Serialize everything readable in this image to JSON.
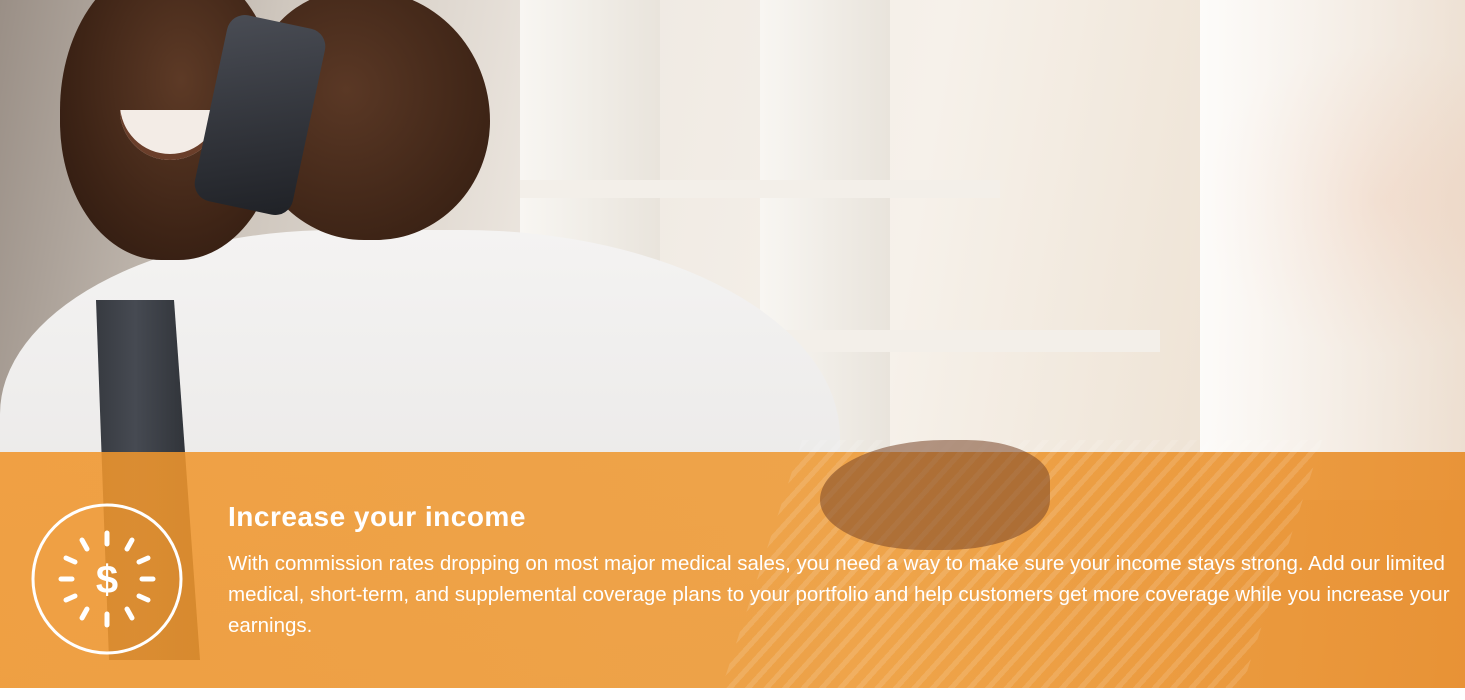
{
  "feature": {
    "icon": "dollar-sunburst-icon",
    "icon_symbol": "$",
    "title": "Increase your income",
    "description": "With commission rates dropping on most major medical sales, you need a way to make sure your income stays strong. Add our limited medical, short-term, and supplemental coverage plans to your portfolio and help customers get more coverage while you increase your earnings."
  },
  "colors": {
    "banner_orange": "#F0962D",
    "text": "#FFFFFF"
  }
}
